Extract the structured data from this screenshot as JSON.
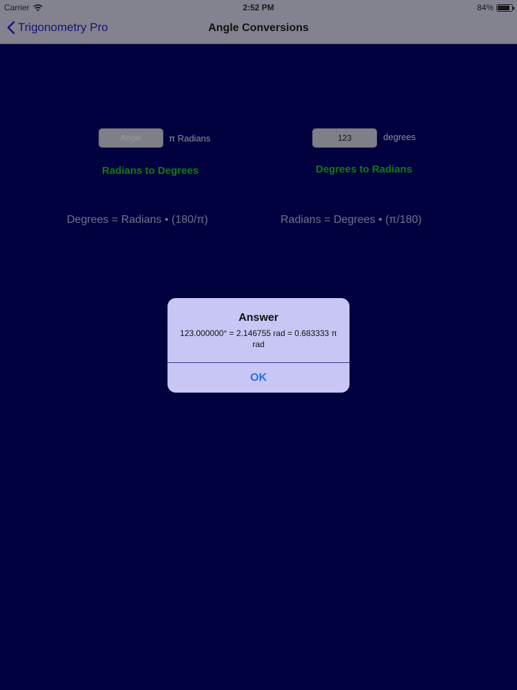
{
  "status_bar": {
    "carrier": "Carrier",
    "time": "2:52 PM",
    "battery": "84%",
    "battery_level": 0.84
  },
  "nav": {
    "back_label": "Trigonometry Pro",
    "title": "Angle Conversions"
  },
  "radians_panel": {
    "input_placeholder": "Angle",
    "input_value": "",
    "unit_label": "π Radians",
    "button_label": "Radians to Degrees",
    "formula": "Degrees = Radians • (180/π)"
  },
  "degrees_panel": {
    "input_value": "123",
    "unit_label": "degrees",
    "button_label": "Degrees to Radians",
    "formula": "Radians = Degrees • (π/180)"
  },
  "alert": {
    "title": "Answer",
    "message": "123.000000° = 2.146755 rad = 0.683333 π rad",
    "ok_label": "OK"
  },
  "colors": {
    "background": "#02013f",
    "button_green": "#0f7d0f",
    "link_blue": "#2a6fe8"
  }
}
